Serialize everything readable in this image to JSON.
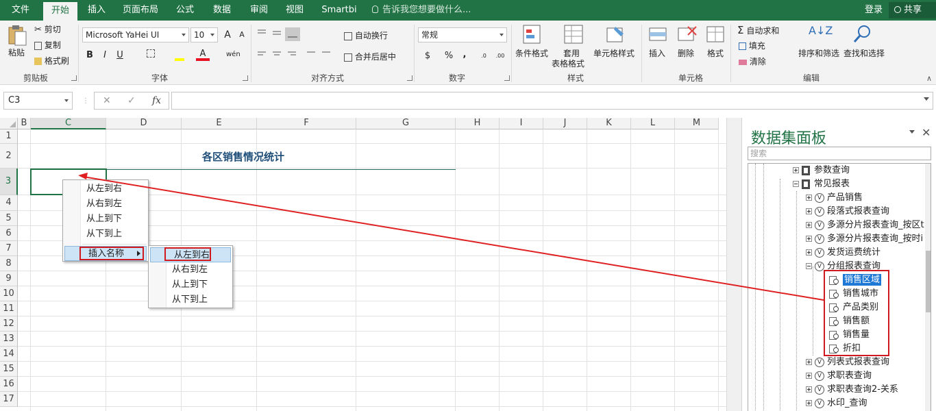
{
  "ribbon_tabs": {
    "file": "文件",
    "home": "开始",
    "insert": "插入",
    "layout": "页面布局",
    "formula": "公式",
    "data": "数据",
    "review": "审阅",
    "view": "视图",
    "smartbi": "Smartbi"
  },
  "tell_me": "告诉我您想要做什么...",
  "login": "登录",
  "share": "共享",
  "clipboard": {
    "paste": "粘贴",
    "cut": "剪切",
    "copy": "复制",
    "format_painter": "格式刷",
    "label": "剪贴板"
  },
  "font": {
    "name": "Microsoft YaHei UI",
    "size": "10",
    "bold": "B",
    "italic": "I",
    "underline": "U",
    "grow": "A",
    "shrink": "A",
    "label": "字体",
    "phonetic": "wén"
  },
  "alignment": {
    "wrap": "自动换行",
    "merge": "合并后居中",
    "label": "对齐方式"
  },
  "number": {
    "format": "常规",
    "currency": "$",
    "percent": "%",
    "comma": ",",
    "label": "数字"
  },
  "styles": {
    "conditional": "条件格式",
    "table_fmt_1": "套用",
    "table_fmt_2": "表格格式",
    "cell_styles": "单元格样式",
    "label": "样式"
  },
  "cells": {
    "insert": "插入",
    "delete": "删除",
    "format": "格式",
    "label": "单元格"
  },
  "editing": {
    "autosum": "自动求和",
    "fill": "填充",
    "clear": "清除",
    "sort_filter": "排序和筛选",
    "find_select": "查找和选择",
    "label": "编辑"
  },
  "formula_bar": {
    "name_box": "C3",
    "cancel": "✕",
    "enter": "✓",
    "fx": "fx",
    "value": ""
  },
  "grid": {
    "columns": [
      "B",
      "C",
      "D",
      "E",
      "F",
      "G",
      "H",
      "I",
      "J",
      "K",
      "L",
      "M"
    ],
    "rows": [
      "1",
      "2",
      "3",
      "4",
      "5",
      "6",
      "7",
      "8",
      "9",
      "10",
      "11",
      "12",
      "13",
      "14",
      "15",
      "16",
      "17"
    ],
    "title": "各区销售情况统计"
  },
  "context_menu": {
    "items": [
      "从左到右",
      "从右到左",
      "从上到下",
      "从下到上"
    ],
    "insert_name": "插入名称"
  },
  "submenu": {
    "items": [
      "从左到右",
      "从右到左",
      "从上到下",
      "从下到上"
    ]
  },
  "panel": {
    "title": "数据集面板",
    "search_placeholder": "搜索",
    "folders": [
      "参数查询",
      "常见报表"
    ],
    "queries": [
      "产品销售",
      "段落式报表查询",
      "多源分片报表查询_按区t",
      "多源分片报表查询_按时i",
      "发货运费统计",
      "分组报表查询"
    ],
    "fields": [
      "销售区域",
      "销售城市",
      "产品类别",
      "销售额",
      "销售量",
      "折扣"
    ],
    "more_queries": [
      "列表式报表查询",
      "求职表查询",
      "求职表查询2-关系",
      "水印_查询"
    ]
  },
  "colors": {
    "excel_green": "#217346",
    "highlight_red": "#d0191f",
    "select_blue": "#1e78d6"
  }
}
